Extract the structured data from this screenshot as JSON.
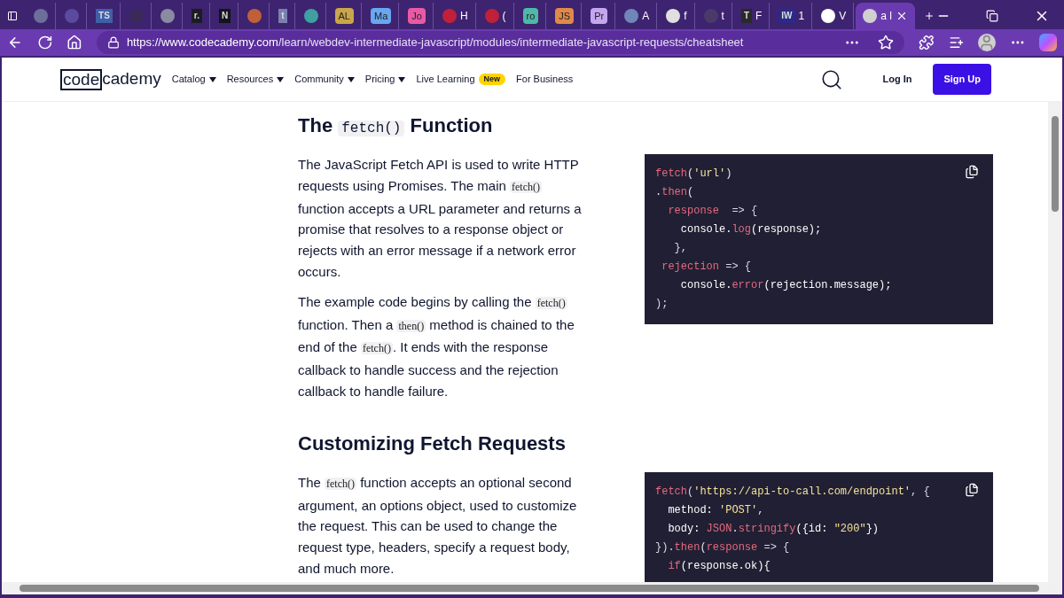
{
  "browser": {
    "tabs": [
      {
        "kind": "icon",
        "color": "#6b6f9a",
        "selected": false
      },
      {
        "kind": "icon",
        "color": "#5b4a9e",
        "selected": false
      },
      {
        "kind": "glyph",
        "badge": "TS",
        "color": "#3f5fa8",
        "selected": false
      },
      {
        "kind": "icon",
        "color": "#3a2a5a",
        "selected": false
      },
      {
        "kind": "icon",
        "color": "#8a8aa0",
        "selected": false
      },
      {
        "kind": "glyph",
        "badge": "r.",
        "color": "#1c1c24",
        "selected": false
      },
      {
        "kind": "glyph",
        "badge": "N",
        "color": "#14141c",
        "selected": false
      },
      {
        "kind": "icon",
        "color": "#c0603a",
        "selected": false
      },
      {
        "kind": "glyph",
        "badge": "t",
        "color": "#7a7fb0",
        "selected": false
      },
      {
        "kind": "icon",
        "color": "#3fa0a0",
        "selected": false
      },
      {
        "kind": "letter",
        "badge": "AL",
        "color": "#c9a64a",
        "selected": false
      },
      {
        "kind": "letter",
        "badge": "Ma",
        "color": "#6aa7f0",
        "selected": false
      },
      {
        "kind": "letter",
        "badge": "Jo",
        "color": "#e85aa5",
        "selected": false
      },
      {
        "kind": "icon",
        "color": "#c0203a",
        "title": "H",
        "selected": false
      },
      {
        "kind": "icon",
        "color": "#c0203a",
        "title": "(",
        "selected": false
      },
      {
        "kind": "letter",
        "badge": "ro",
        "color": "#4fb8a8",
        "selected": false
      },
      {
        "kind": "letter",
        "badge": "JS",
        "color": "#e0894a",
        "selected": false
      },
      {
        "kind": "letter",
        "badge": "Pr",
        "color": "#c4a6f0",
        "selected": false
      },
      {
        "kind": "icon",
        "color": "#6f86b8",
        "title": "A",
        "selected": false
      },
      {
        "kind": "icon",
        "color": "#e0e0e0",
        "title": "f",
        "selected": false
      },
      {
        "kind": "icon",
        "color": "#4a3a6a",
        "title": "t",
        "selected": false
      },
      {
        "kind": "glyph",
        "badge": "T",
        "color": "#2a2a2a",
        "title": "F",
        "selected": false
      },
      {
        "kind": "glyph",
        "badge": "IW",
        "color": "#2a2a8a",
        "title": "1",
        "selected": false
      },
      {
        "kind": "icon",
        "color": "#ffffff",
        "title": "V",
        "selected": false
      },
      {
        "kind": "icon",
        "color": "#d0d0d0",
        "title": "a l",
        "selected": true
      }
    ],
    "url": {
      "host": "https://www.codecademy.com",
      "path": "/learn/webdev-intermediate-javascript/modules/intermediate-javascript-requests/cheatsheet"
    }
  },
  "nav": {
    "logo": {
      "boxed": "code",
      "rest": "cademy"
    },
    "items": [
      {
        "label": "Catalog",
        "dropdown": true
      },
      {
        "label": "Resources",
        "dropdown": true
      },
      {
        "label": "Community",
        "dropdown": true
      },
      {
        "label": "Pricing",
        "dropdown": true
      },
      {
        "label": "Live Learning",
        "dropdown": false,
        "badge": "New"
      },
      {
        "label": "For Business",
        "dropdown": false
      }
    ],
    "login": "Log In",
    "signup": "Sign Up"
  },
  "sections": [
    {
      "heading": [
        {
          "kind": "text",
          "text": "The "
        },
        {
          "kind": "code",
          "text": "fetch()"
        },
        {
          "kind": "text",
          "text": " Function"
        }
      ],
      "paragraphs": [
        [
          {
            "kind": "text",
            "text": "The JavaScript Fetch API is used to write HTTP requests using Promises. The main "
          },
          {
            "kind": "code",
            "text": "fetch()"
          },
          {
            "kind": "text",
            "text": " function accepts a URL parameter and returns a promise that resolves to a response object or rejects with an error message if a network error occurs."
          }
        ],
        [
          {
            "kind": "text",
            "text": "The example code begins by calling the "
          },
          {
            "kind": "code",
            "text": "fetch()"
          },
          {
            "kind": "text",
            "text": " function. Then a "
          },
          {
            "kind": "code",
            "text": "then()"
          },
          {
            "kind": "text",
            "text": " method is chained to the end of the "
          },
          {
            "kind": "code",
            "text": "fetch()"
          },
          {
            "kind": "text",
            "text": ". It ends with the response callback to handle success and the rejection callback to handle failure."
          }
        ]
      ],
      "code": [
        [
          {
            "text": "fetch",
            "color": "#e36a7f"
          },
          {
            "text": "("
          },
          {
            "text": "'url'",
            "color": "#f4e49a"
          },
          {
            "text": ")"
          }
        ],
        [
          {
            "text": "."
          },
          {
            "text": "then",
            "color": "#e36a7f"
          },
          {
            "text": "("
          }
        ],
        [
          {
            "text": "  response",
            "color": "#e36a7f"
          },
          {
            "text": "  => {",
            "color": "#d8d8e0"
          }
        ],
        [
          {
            "text": "    console.",
            "color": "#ffffff"
          },
          {
            "text": "log",
            "color": "#e36a7f"
          },
          {
            "text": "(response);",
            "color": "#ffffff"
          }
        ],
        [
          {
            "text": "   },",
            "color": "#d8d8e0"
          }
        ],
        [
          {
            "text": " rejection",
            "color": "#e36a7f"
          },
          {
            "text": " => {",
            "color": "#d8d8e0"
          }
        ],
        [
          {
            "text": "    console.",
            "color": "#ffffff"
          },
          {
            "text": "error",
            "color": "#e36a7f"
          },
          {
            "text": "(rejection.message);",
            "color": "#ffffff"
          }
        ],
        [
          {
            "text": ");",
            "color": "#d8d8e0"
          }
        ]
      ]
    },
    {
      "heading": [
        {
          "kind": "text",
          "text": "Customizing Fetch Requests"
        }
      ],
      "paragraphs": [
        [
          {
            "kind": "text",
            "text": "The "
          },
          {
            "kind": "code",
            "text": "fetch()"
          },
          {
            "kind": "text",
            "text": " function accepts an optional second argument, an options object, used to customize the request. This can be used to change the request type, headers, specify a request body, and much more."
          }
        ]
      ],
      "code": [
        [
          {
            "text": "fetch",
            "color": "#e36a7f"
          },
          {
            "text": "(",
            "color": "#d8d8e0"
          },
          {
            "text": "'https://api-to-call.com/endpoint'",
            "color": "#f4e49a"
          },
          {
            "text": ", {",
            "color": "#d8d8e0"
          }
        ],
        [
          {
            "text": "  method: ",
            "color": "#ffffff"
          },
          {
            "text": "'POST'",
            "color": "#f4e49a"
          },
          {
            "text": ","
          }
        ],
        [
          {
            "text": "  body: ",
            "color": "#ffffff"
          },
          {
            "text": "JSON",
            "color": "#e36a7f"
          },
          {
            "text": "."
          },
          {
            "text": "stringify",
            "color": "#e36a7f"
          },
          {
            "text": "({id: ",
            "color": "#ffffff"
          },
          {
            "text": "\"200\"",
            "color": "#f4e49a"
          },
          {
            "text": "})",
            "color": "#ffffff"
          }
        ],
        [
          {
            "text": "}).",
            "color": "#d8d8e0"
          },
          {
            "text": "then",
            "color": "#e36a7f"
          },
          {
            "text": "("
          },
          {
            "text": "response",
            "color": "#e36a7f"
          },
          {
            "text": " => {",
            "color": "#d8d8e0"
          }
        ],
        [
          {
            "text": "  if",
            "color": "#e36a7f"
          },
          {
            "text": "(response.ok){",
            "color": "#ffffff"
          }
        ]
      ]
    }
  ]
}
